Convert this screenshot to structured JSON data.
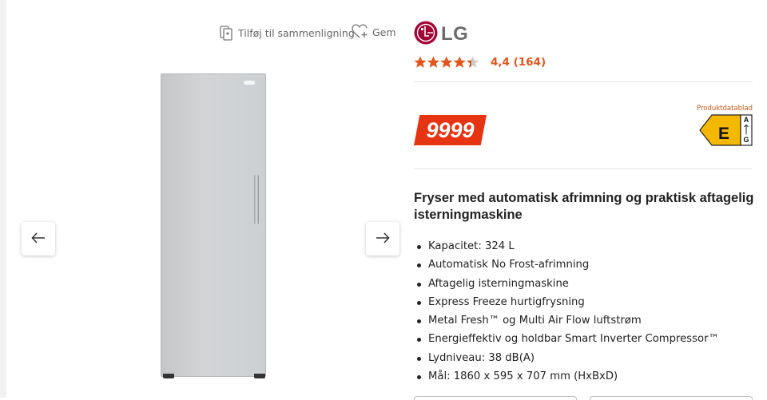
{
  "actions": {
    "compare_label": "Tilføj til sammenligning",
    "save_label": "Gem"
  },
  "gallery": {
    "prev_icon": "arrow-left-icon",
    "next_icon": "arrow-right-icon",
    "image": "freezer-product-image"
  },
  "brand": {
    "name": "LG",
    "logo_color": "#a50034"
  },
  "rating": {
    "score": 4.4,
    "text": "4,4 (164)",
    "star_color": "#e2561c"
  },
  "price": {
    "value": "9999",
    "color": "#e63312"
  },
  "energy": {
    "link_label": "Produktdatablad",
    "grade": "E",
    "scale_top": "A",
    "scale_bottom": "G",
    "color": "#f5b800"
  },
  "product": {
    "title": "Fryser med automatisk afrimning og praktisk aftagelig isterningmaskine",
    "features": [
      "Kapacitet: 324 L",
      "Automatisk No Frost-afrimning",
      "Aftagelig isterningmaskine",
      "Express Freeze hurtigfrysning",
      "Metal Fresh™ og Multi Air Flow luftstrøm",
      "Energieffektiv og holdbar Smart Inverter Compressor™",
      "Lydniveau: 38 dB(A)",
      "Mål: 1860 x 595 x 707 mm (HxBxD)"
    ]
  }
}
